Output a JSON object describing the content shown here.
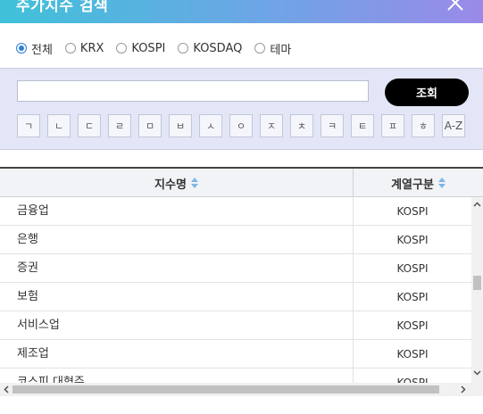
{
  "window": {
    "title": "주가지수 검색"
  },
  "radios": [
    {
      "label": "전체",
      "checked": true
    },
    {
      "label": "KRX",
      "checked": false
    },
    {
      "label": "KOSPI",
      "checked": false
    },
    {
      "label": "KOSDAQ",
      "checked": false
    },
    {
      "label": "테마",
      "checked": false
    }
  ],
  "search": {
    "value": "",
    "placeholder": "",
    "button_label": "조회"
  },
  "letters": [
    "ㄱ",
    "ㄴ",
    "ㄷ",
    "ㄹ",
    "ㅁ",
    "ㅂ",
    "ㅅ",
    "ㅇ",
    "ㅈ",
    "ㅊ",
    "ㅋ",
    "ㅌ",
    "ㅍ",
    "ㅎ",
    "A-Z"
  ],
  "table": {
    "columns": [
      "지수명",
      "계열구분"
    ],
    "rows": [
      {
        "name": "금융업",
        "type": "KOSPI"
      },
      {
        "name": "은행",
        "type": "KOSPI"
      },
      {
        "name": "증권",
        "type": "KOSPI"
      },
      {
        "name": "보험",
        "type": "KOSPI"
      },
      {
        "name": "서비스업",
        "type": "KOSPI"
      },
      {
        "name": "제조업",
        "type": "KOSPI"
      },
      {
        "name": "코스피 대형주",
        "type": "KOSPI"
      }
    ]
  },
  "colors": {
    "accent": "#2f7fd6",
    "title_gradient_start": "#3fc1d9",
    "title_gradient_end": "#9a8ae8",
    "search_panel_bg": "#e3e6f7"
  }
}
